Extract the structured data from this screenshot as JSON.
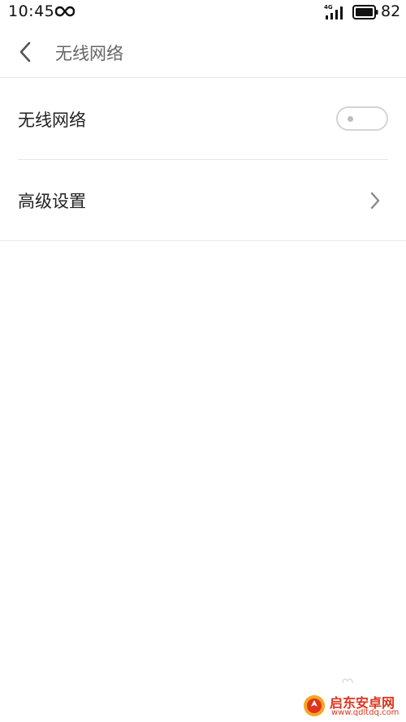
{
  "status_bar": {
    "time": "10:45",
    "network_type": "4G",
    "battery_level": "82",
    "icons": [
      "infinity-icon",
      "signal-icon",
      "battery-icon"
    ]
  },
  "header": {
    "back_icon": "chevron-left-icon",
    "title": "无线网络"
  },
  "settings": {
    "wifi": {
      "label": "无线网络",
      "toggle_state": "off"
    },
    "advanced": {
      "label": "高级设置",
      "icon": "chevron-right-icon"
    }
  },
  "watermark": {
    "name": "启东安卓网",
    "url": "www.qdltdq.com"
  },
  "colors": {
    "divider": "#e6e6e6",
    "title_gray": "#666666",
    "text": "#222222",
    "toggle_border": "#d4d4d4",
    "watermark_red": "#e0341d"
  }
}
